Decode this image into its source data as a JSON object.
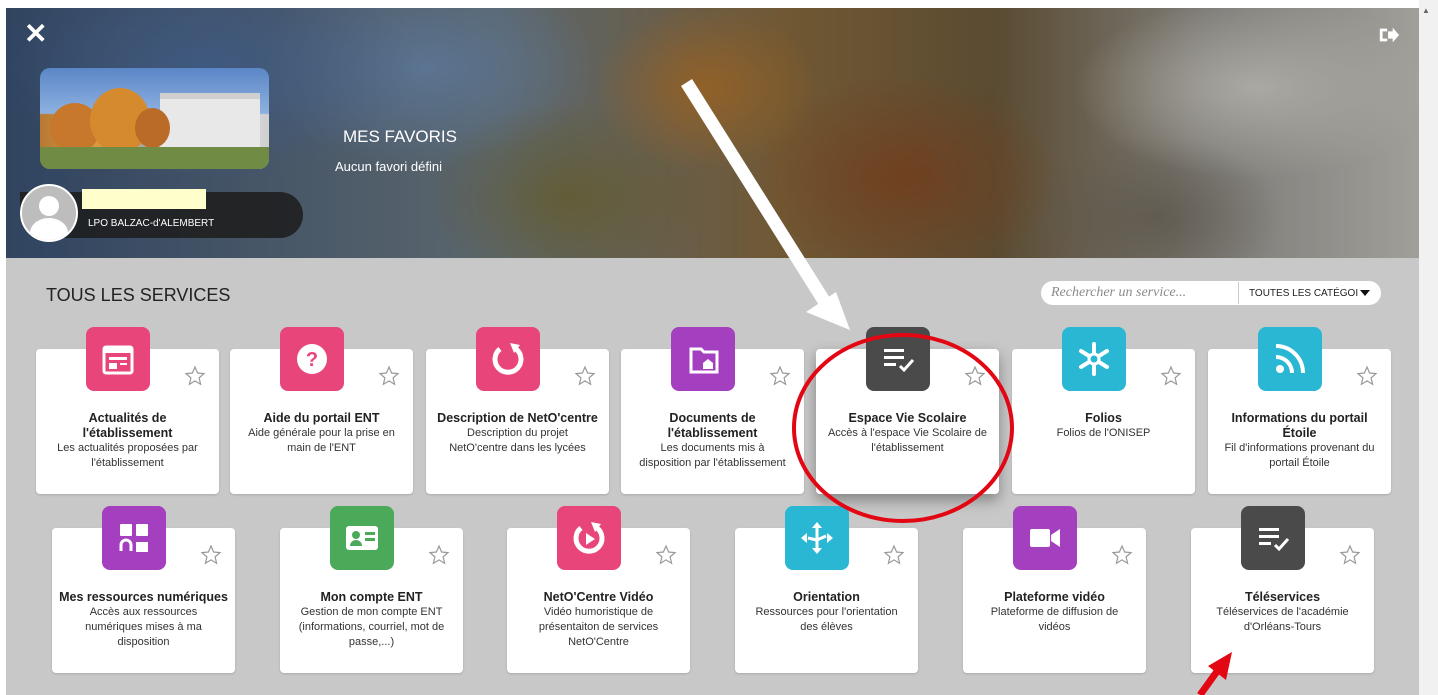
{
  "header": {
    "favorites_title": "MES FAVORIS",
    "favorites_empty": "Aucun favori défini",
    "user_school": "LPO BALZAC-d'ALEMBERT"
  },
  "services": {
    "title": "TOUS LES SERVICES",
    "search_placeholder": "Rechercher un service...",
    "category_filter": "TOUTES LES CATÉGOI",
    "items": [
      {
        "title": "Actualités de l'établissement",
        "title_lines": [
          "Actualités de",
          "l'établissement"
        ],
        "desc_lines": [
          "Les actualités proposées par",
          "l'établissement"
        ],
        "color": "#e8457a",
        "icon": "news-icon"
      },
      {
        "title": "Aide du portail ENT",
        "title_lines": [
          "Aide du portail ENT"
        ],
        "desc_lines": [
          "Aide générale pour la prise en",
          "main de l'ENT"
        ],
        "color": "#e8457a",
        "icon": "help-icon"
      },
      {
        "title": "Description de NetO'centre",
        "title_lines": [
          "Description de NetO'centre"
        ],
        "desc_lines": [
          "Description du projet",
          "NetO'centre dans les lycées"
        ],
        "color": "#e8457a",
        "icon": "logo-icon"
      },
      {
        "title": "Documents de l'établissement",
        "title_lines": [
          "Documents de",
          "l'établissement"
        ],
        "desc_lines": [
          "Les documents mis à",
          "disposition par l'établissement"
        ],
        "color": "#a43fbf",
        "icon": "folder-icon"
      },
      {
        "title": "Espace Vie Scolaire",
        "title_lines": [
          "Espace Vie Scolaire"
        ],
        "desc_lines": [
          "Accès à l'espace Vie Scolaire de",
          "l'établissement"
        ],
        "color": "#4a4a4a",
        "icon": "checklist-icon"
      },
      {
        "title": "Folios",
        "title_lines": [
          "Folios"
        ],
        "desc_lines": [
          "Folios de l'ONISEP"
        ],
        "color": "#29b7d4",
        "icon": "asterisk-icon"
      },
      {
        "title": "Informations du portail Étoile",
        "title_lines": [
          "Informations du portail",
          "Étoile"
        ],
        "desc_lines": [
          "Fil d'informations provenant du",
          "portail Étoile"
        ],
        "color": "#29b7d4",
        "icon": "rss-icon"
      },
      {
        "title": "Mes ressources numériques",
        "title_lines": [
          "Mes ressources numériques"
        ],
        "desc_lines": [
          "Accès aux ressources",
          "numériques mises à ma",
          "disposition"
        ],
        "color": "#a43fbf",
        "icon": "resources-icon"
      },
      {
        "title": "Mon compte ENT",
        "title_lines": [
          "Mon compte ENT"
        ],
        "desc_lines": [
          "Gestion de mon compte ENT",
          "(informations, courriel, mot de",
          "passe,...)"
        ],
        "color": "#4aaa5a",
        "icon": "id-card-icon"
      },
      {
        "title": "NetO'Centre Vidéo",
        "title_lines": [
          "NetO'Centre Vidéo"
        ],
        "desc_lines": [
          "Vidéo humoristique de",
          "présentaiton de services",
          "NetO'Centre"
        ],
        "color": "#e8457a",
        "icon": "video-logo-icon"
      },
      {
        "title": "Orientation",
        "title_lines": [
          "Orientation"
        ],
        "desc_lines": [
          "Ressources pour l'orientation",
          "des élèves"
        ],
        "color": "#29b7d4",
        "icon": "directions-icon"
      },
      {
        "title": "Plateforme vidéo",
        "title_lines": [
          "Plateforme vidéo"
        ],
        "desc_lines": [
          "Plateforme de diffusion de",
          "vidéos"
        ],
        "color": "#a43fbf",
        "icon": "camera-icon"
      },
      {
        "title": "Téléservices",
        "title_lines": [
          "Téléservices"
        ],
        "desc_lines": [
          "Téléservices de l'académie",
          "d'Orléans-Tours"
        ],
        "color": "#4a4a4a",
        "icon": "checklist-icon"
      }
    ]
  },
  "annotations": {
    "highlight_color": "#e30613",
    "arrow_color": "#ffffff"
  }
}
